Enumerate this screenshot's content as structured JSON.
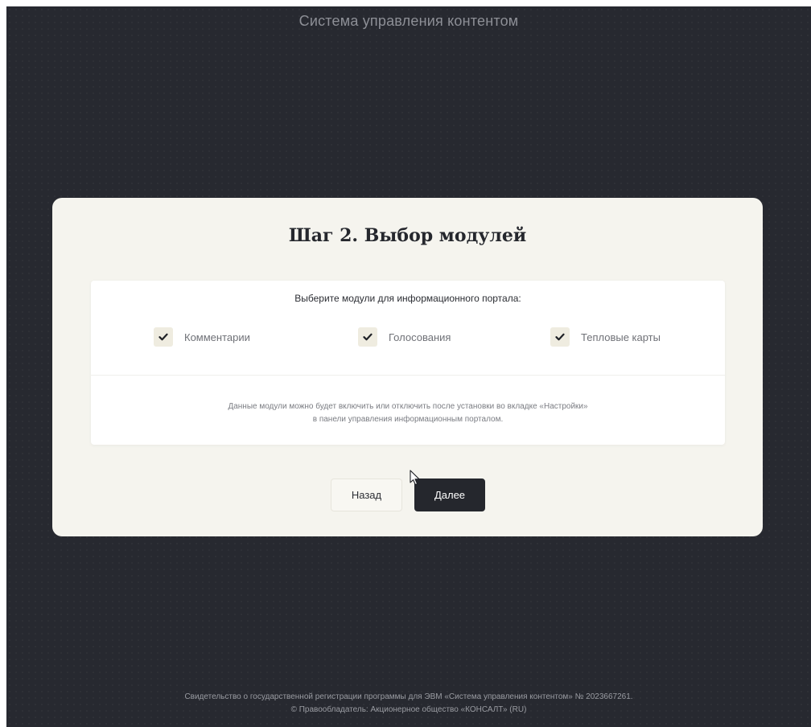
{
  "app": {
    "title": "Система управления контентом"
  },
  "step": {
    "title": "Шаг 2. Выбор модулей"
  },
  "modules": {
    "prompt": "Выберите модули для информационного портала:",
    "items": [
      {
        "label": "Комментарии",
        "checked": true
      },
      {
        "label": "Голосования",
        "checked": true
      },
      {
        "label": "Тепловые карты",
        "checked": true
      }
    ],
    "note_line1": "Данные модули можно будет включить или отключить после установки во вкладке «Настройки»",
    "note_line2": "в панели управления информационным порталом."
  },
  "actions": {
    "back_label": "Назад",
    "next_label": "Далее"
  },
  "footer": {
    "line1": "Свидетельство о государственной регистрации программы для ЭВМ «Система управления контентом» № 2023667261.",
    "line2": "© Правообладатель: Акционерное общество «КОНСАЛТ» (RU)"
  },
  "colors": {
    "background": "#272930",
    "card": "#f5f4ee",
    "panel": "#ffffff",
    "checkbox": "#efece0",
    "primary_button": "#25272d"
  },
  "icons": {
    "checkbox_check": "check-icon",
    "pointer": "mouse-cursor-icon"
  }
}
